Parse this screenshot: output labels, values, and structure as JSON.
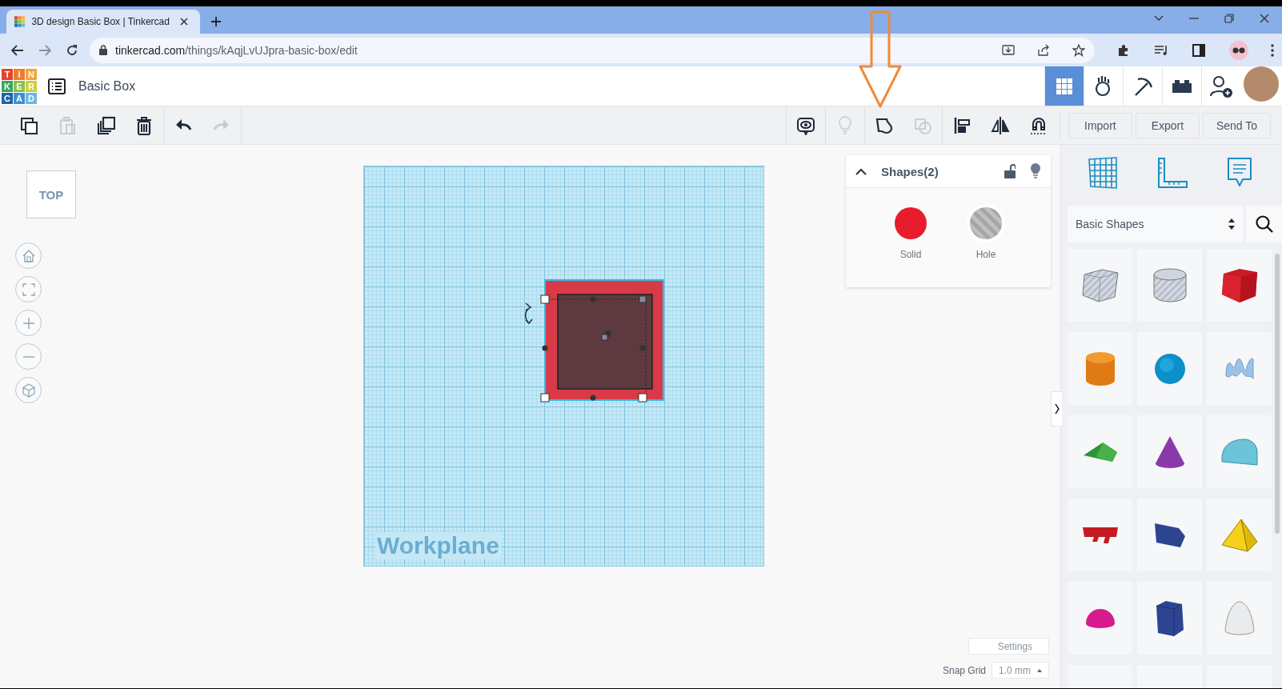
{
  "browser": {
    "tab_title": "3D design Basic Box | Tinkercad",
    "url_host": "tinkercad.com",
    "url_path": "/things/kAqjLvUJpra-basic-box/edit"
  },
  "header": {
    "logo_letters": [
      "T",
      "I",
      "N",
      "K",
      "E",
      "R",
      "C",
      "A",
      "D"
    ],
    "design_title": "Basic Box",
    "view_modes": [
      {
        "kind": "grid",
        "selected": true
      },
      {
        "kind": "hand",
        "selected": false
      },
      {
        "kind": "pickaxe",
        "selected": false
      },
      {
        "kind": "brick",
        "selected": false
      }
    ]
  },
  "toolbar": {
    "left_tools": [
      {
        "kind": "copy",
        "disabled": false
      },
      {
        "kind": "paste",
        "disabled": true
      },
      {
        "kind": "duplicate",
        "disabled": false
      },
      {
        "kind": "delete",
        "disabled": false
      },
      {
        "kind": "undo",
        "disabled": false
      },
      {
        "kind": "redo",
        "disabled": true
      }
    ],
    "right_tools": [
      {
        "kind": "notes",
        "disabled": false
      },
      {
        "kind": "bulb",
        "disabled": true
      },
      {
        "kind": "group",
        "disabled": false
      },
      {
        "kind": "ungroup",
        "disabled": true
      },
      {
        "kind": "align",
        "disabled": false
      },
      {
        "kind": "mirror",
        "disabled": false
      },
      {
        "kind": "magnet",
        "disabled": false
      }
    ],
    "actions": [
      "Import",
      "Export",
      "Send To"
    ]
  },
  "view_cube": "TOP",
  "workplane": {
    "label": "Workplane"
  },
  "inspector": {
    "title": "Shapes(2)",
    "expanded": true,
    "options": [
      {
        "kind": "solid",
        "label": "Solid"
      },
      {
        "kind": "hole",
        "label": "Hole"
      }
    ]
  },
  "footer": {
    "settings": "Settings",
    "snap_label": "Snap Grid",
    "snap_value": "1.0 mm"
  },
  "library": {
    "category": "Basic Shapes",
    "shapes": [
      {
        "kind": "box-hole"
      },
      {
        "kind": "cylinder-hole"
      },
      {
        "kind": "box"
      },
      {
        "kind": "cylinder"
      },
      {
        "kind": "sphere"
      },
      {
        "kind": "scribble"
      },
      {
        "kind": "roof"
      },
      {
        "kind": "cone"
      },
      {
        "kind": "round-roof"
      },
      {
        "kind": "text"
      },
      {
        "kind": "wedge"
      },
      {
        "kind": "pyramid"
      },
      {
        "kind": "half-sphere"
      },
      {
        "kind": "polygon"
      },
      {
        "kind": "paraboloid"
      },
      {
        "kind": "blank"
      },
      {
        "kind": "blank"
      },
      {
        "kind": "blank"
      }
    ]
  }
}
